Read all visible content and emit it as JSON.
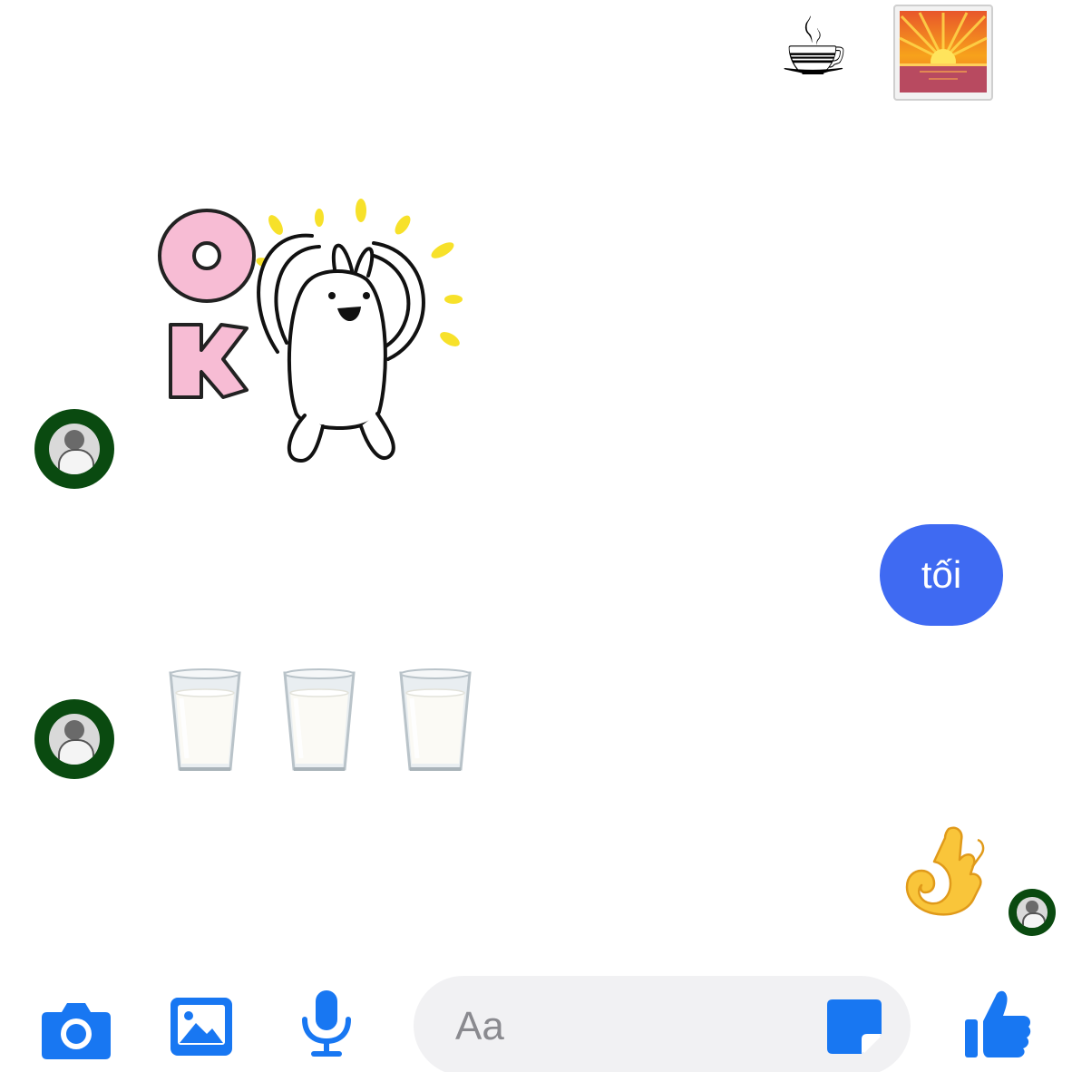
{
  "top_row": {
    "coffee_emoji": "☕",
    "sunrise_icon": "sunrise-photo-icon"
  },
  "thread": {
    "incoming_sticker": "ok-rabbit-sticker",
    "sticker_letters": [
      "O",
      "K"
    ],
    "outgoing_message": "tối",
    "incoming_emojis": [
      "milk-glass-icon",
      "milk-glass-icon",
      "milk-glass-icon"
    ],
    "outgoing_emoji": "ok-hand-icon"
  },
  "composer": {
    "placeholder": "Aa",
    "icons": [
      "camera-icon",
      "image-icon",
      "microphone-icon",
      "sticker-icon",
      "thumbs-up-icon"
    ]
  },
  "colors": {
    "accent": "#1877f2",
    "bubble": "#3f6af2",
    "composer_bg": "#f1f1f3",
    "avatar_bg": "#0a4a10"
  }
}
